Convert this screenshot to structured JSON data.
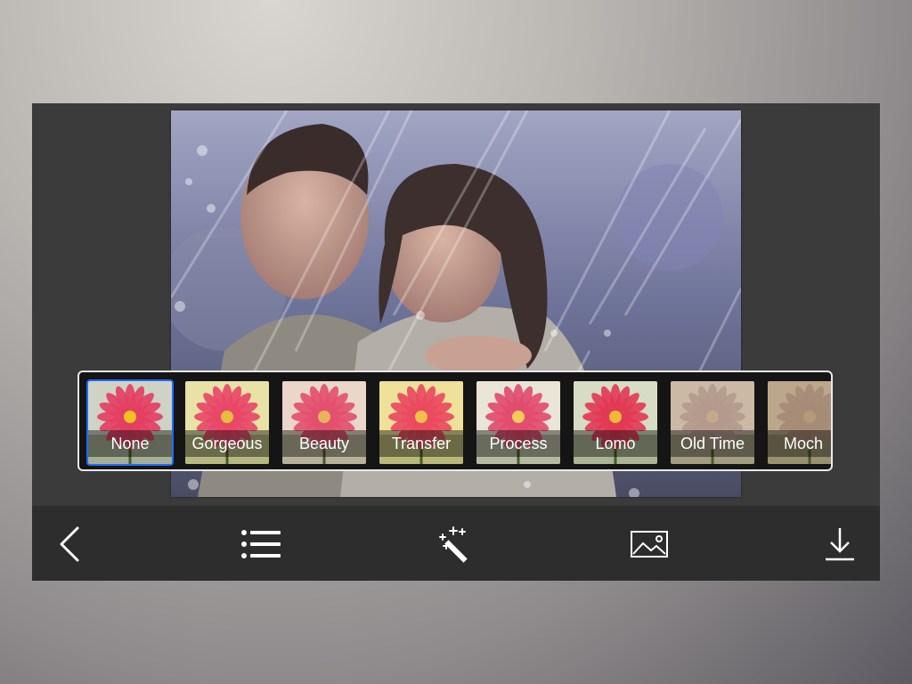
{
  "colors": {
    "selection_border": "#1f6bff",
    "toolbar_bg": "#2d2d2e",
    "strip_border": "#e9e9e9"
  },
  "filters": [
    {
      "label": "None",
      "selected": true,
      "tint": "#cfd3c6"
    },
    {
      "label": "Gorgeous",
      "selected": false,
      "tint": "#e8e2a6"
    },
    {
      "label": "Beauty",
      "selected": false,
      "tint": "#ead7c9"
    },
    {
      "label": "Transfer",
      "selected": false,
      "tint": "#efe09a"
    },
    {
      "label": "Process",
      "selected": false,
      "tint": "#e9e6d7"
    },
    {
      "label": "Lomo",
      "selected": false,
      "tint": "#d7dcc4"
    },
    {
      "label": "Old Time",
      "selected": false,
      "tint": "#cbb9a6"
    },
    {
      "label": "Moch",
      "selected": false,
      "tint": "#bca78b"
    }
  ],
  "toolbar": {
    "back": "chevron-left-icon",
    "list": "list-icon",
    "effects": "magic-wand-icon",
    "gallery": "image-icon",
    "save": "download-icon"
  }
}
